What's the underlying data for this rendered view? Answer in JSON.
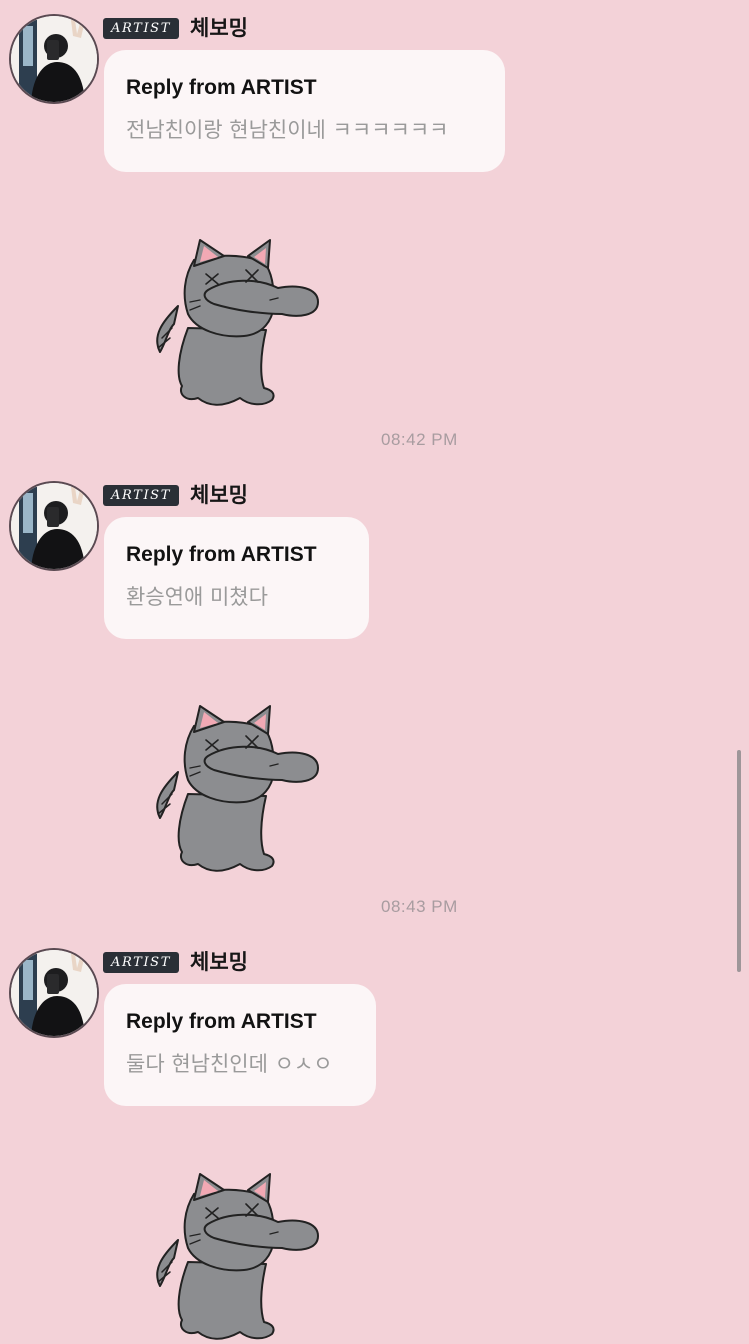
{
  "messages": [
    {
      "badge": "ARTIST",
      "sender": "체보밍",
      "reply_title": "Reply from ARTIST",
      "reply_text": "전남친이랑 현남친이네 ㅋㅋㅋㅋㅋㅋ",
      "sticker": "gray-cat-facepalm-sticker",
      "time": "08:42 PM"
    },
    {
      "badge": "ARTIST",
      "sender": "체보밍",
      "reply_title": "Reply from ARTIST",
      "reply_text": "환승연애 미쳤다",
      "sticker": "gray-cat-facepalm-sticker",
      "time": "08:43 PM"
    },
    {
      "badge": "ARTIST",
      "sender": "체보밍",
      "reply_title": "Reply from ARTIST",
      "reply_text": "둘다 현남친인데 ㅇㅅㅇ",
      "sticker": "gray-cat-facepalm-sticker"
    }
  ],
  "colors": {
    "background": "#f3d2d8",
    "bubble": "#fcf6f7",
    "badge": "#2a2f36",
    "cat_body": "#8c8d90",
    "cat_ear": "#f2a9b4"
  }
}
